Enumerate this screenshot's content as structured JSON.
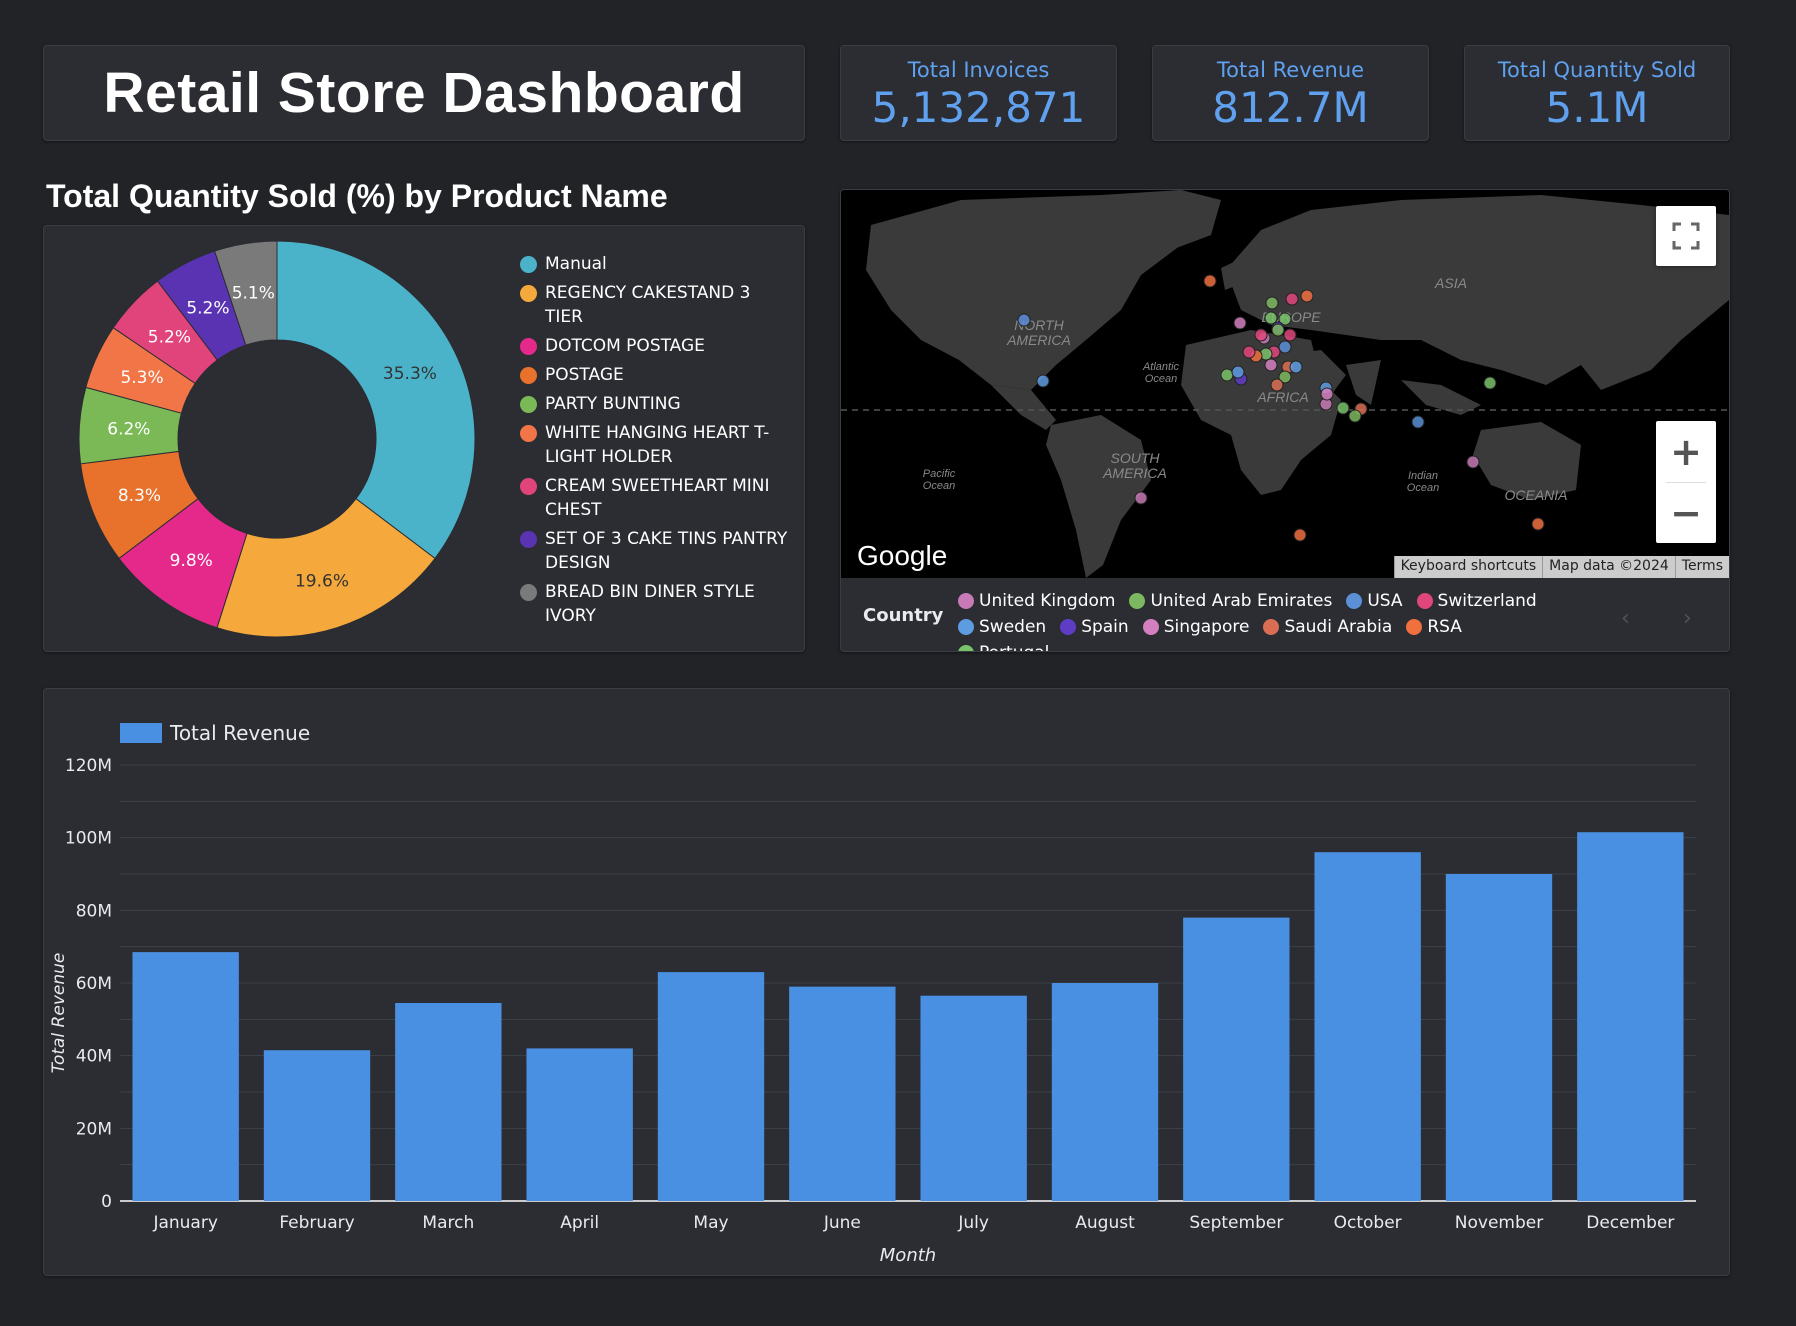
{
  "dashboard": {
    "title": "Retail Store Dashboard"
  },
  "kpis": {
    "invoices": {
      "label": "Total Invoices",
      "value": "5,132,871"
    },
    "revenue": {
      "label": "Total Revenue",
      "value": "812.7M"
    },
    "quantity": {
      "label": "Total Quantity Sold",
      "value": "5.1M"
    }
  },
  "pie": {
    "title": "Total Quantity Sold (%) by Product Name"
  },
  "map": {
    "continent_labels": [
      "NORTH AMERICA",
      "ASIA",
      "EUROPE",
      "AFRICA",
      "SOUTH AMERICA",
      "OCEANIA"
    ],
    "ocean_labels": [
      "Atlantic Ocean",
      "Pacific Ocean",
      "Indian Ocean"
    ],
    "google_logo": "Google",
    "attribution": [
      "Keyboard shortcuts",
      "Map data ©2024",
      "Terms"
    ],
    "zoom_in": "+",
    "zoom_out": "−",
    "country_legend_title": "Country",
    "countries": [
      {
        "name": "United Kingdom",
        "color": "#c77ab5"
      },
      {
        "name": "United Arab Emirates",
        "color": "#7cb860"
      },
      {
        "name": "USA",
        "color": "#5b8fd6"
      },
      {
        "name": "Switzerland",
        "color": "#e0457b"
      },
      {
        "name": "Sweden",
        "color": "#5e9ce0"
      },
      {
        "name": "Spain",
        "color": "#5f3cc4"
      },
      {
        "name": "Singapore",
        "color": "#d47fc0"
      },
      {
        "name": "Saudi Arabia",
        "color": "#d96e54"
      },
      {
        "name": "RSA",
        "color": "#f0703f"
      },
      {
        "name": "Portugal",
        "color": "#79c26a"
      }
    ],
    "colors": {
      "land": "#3a3a3a",
      "water": "#000000"
    }
  },
  "chart_data": [
    {
      "type": "pie",
      "title": "Total Quantity Sold (%) by Product Name",
      "donut": true,
      "labels": [
        "Manual",
        "REGENCY CAKESTAND 3 TIER",
        "DOTCOM POSTAGE",
        "POSTAGE",
        "PARTY BUNTING",
        "WHITE HANGING HEART T-LIGHT HOLDER",
        "CREAM SWEETHEART MINI CHEST",
        "SET OF 3 CAKE TINS PANTRY DESIGN",
        "BREAD BIN DINER STYLE IVORY"
      ],
      "values": [
        35.3,
        19.6,
        9.8,
        8.3,
        6.2,
        5.3,
        5.2,
        5.2,
        5.1
      ],
      "value_labels": [
        "35.3%",
        "19.6%",
        "9.8%",
        "8.3%",
        "6.2%",
        "5.3%",
        "5.2%",
        "5.2%",
        "5.1%"
      ],
      "colors": [
        "#4bb3c9",
        "#f5a83b",
        "#e5298b",
        "#e8712c",
        "#7ab955",
        "#f27548",
        "#e0447a",
        "#5a33b3",
        "#7a7a7a"
      ]
    },
    {
      "type": "bar",
      "categories": [
        "January",
        "February",
        "March",
        "April",
        "May",
        "June",
        "July",
        "August",
        "September",
        "October",
        "November",
        "December"
      ],
      "series": [
        {
          "name": "Total Revenue",
          "values": [
            68.5,
            41.5,
            54.5,
            42,
            63,
            59,
            56.5,
            60,
            78,
            96,
            90,
            101.5
          ],
          "color": "#4a90e2"
        }
      ],
      "ylim": [
        0,
        120
      ],
      "yticks": [
        0,
        20,
        40,
        60,
        80,
        100,
        120
      ],
      "ytick_labels": [
        "0",
        "20M",
        "40M",
        "60M",
        "80M",
        "100M",
        "120M"
      ],
      "xlabel": "Month",
      "ylabel": "Total Revenue",
      "grid": true,
      "legend": "top-left"
    }
  ]
}
